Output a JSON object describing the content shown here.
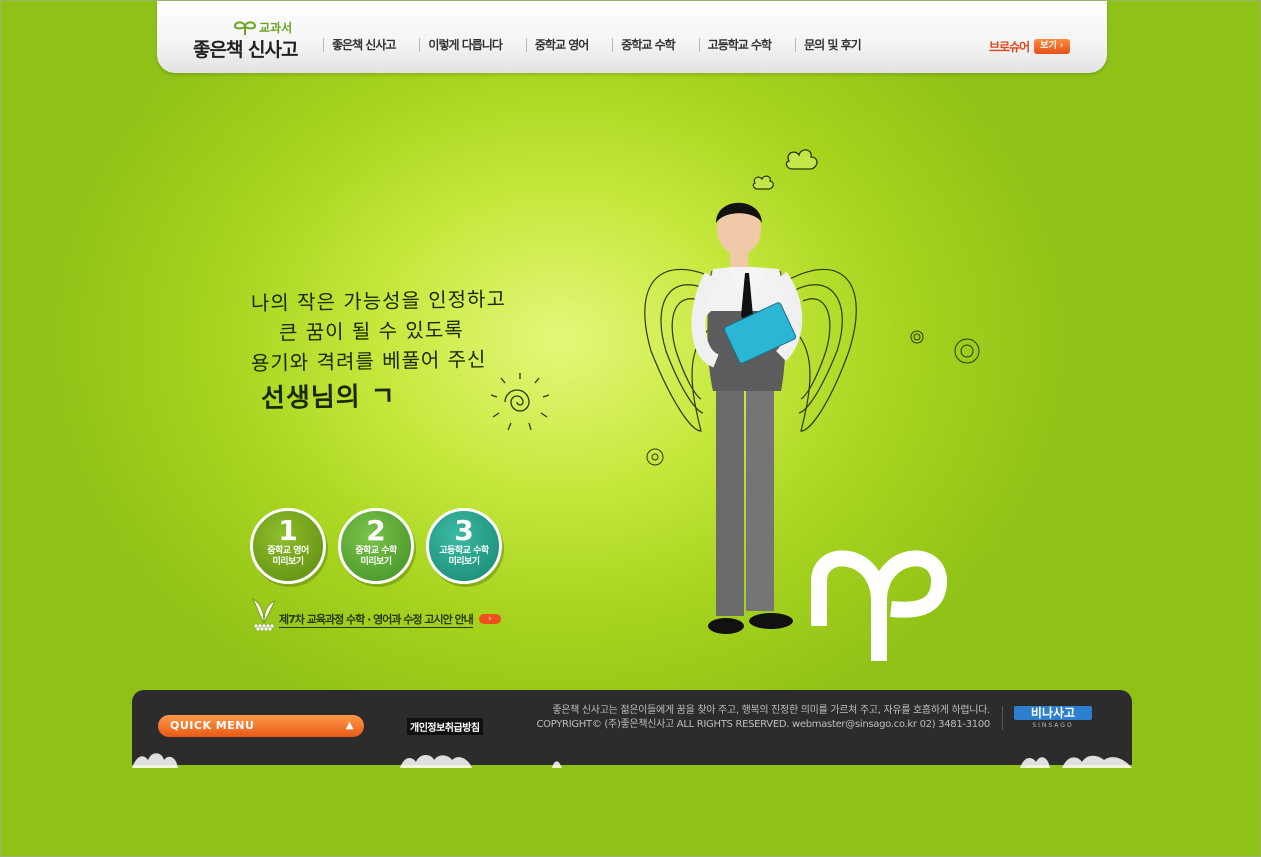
{
  "header": {
    "logo_sub": "교과서",
    "logo_main": "좋은책 신사고",
    "nav": [
      {
        "label": "좋은책 신사고"
      },
      {
        "label": "이렇게 다릅니다"
      },
      {
        "label": "중학교 영어"
      },
      {
        "label": "중학교 수학"
      },
      {
        "label": "고등학교 수학"
      },
      {
        "label": "문의 및 후기"
      }
    ],
    "brochure_label": "브로슈어",
    "brochure_view": "보기"
  },
  "hero": {
    "slogan": [
      "나의 작은 가능성을 인정하고",
      "큰 꿈이 될 수 있도록",
      "용기와 격려를 베풀어 주신",
      "선생님의 ㄱ"
    ]
  },
  "previews": [
    {
      "number": "1",
      "text_line1": "중학교 영어",
      "text_line2": "미리보기"
    },
    {
      "number": "2",
      "text_line1": "중학교 수학",
      "text_line2": "미리보기"
    },
    {
      "number": "3",
      "text_line1": "고등학교 수학",
      "text_line2": "미리보기"
    }
  ],
  "notice": {
    "text": "제7차 교육과정 수학 · 영어과 수정 고시안 안내"
  },
  "footer": {
    "quick_menu": "QUICK MENU",
    "privacy": "개인정보취급방침",
    "slogan_line": "좋은책 신사고는 젊은이들에게 꿈을 찾아 주고, 행복의 진정한 의미를 가르쳐 주고, 자유를 호흡하게 하렵니다.",
    "copyright_line": "COPYRIGHT© (주)좋은책신사고 ALL RIGHTS RESERVED. webmaster@sinsago.co.kr  02) 3481-3100",
    "company_logo": "비나사고",
    "company_logo_en": "SINSAGO"
  },
  "colors": {
    "background_green": "#a8d41f",
    "accent_orange": "#e85a16",
    "footer_dark": "#2c2c2c"
  }
}
